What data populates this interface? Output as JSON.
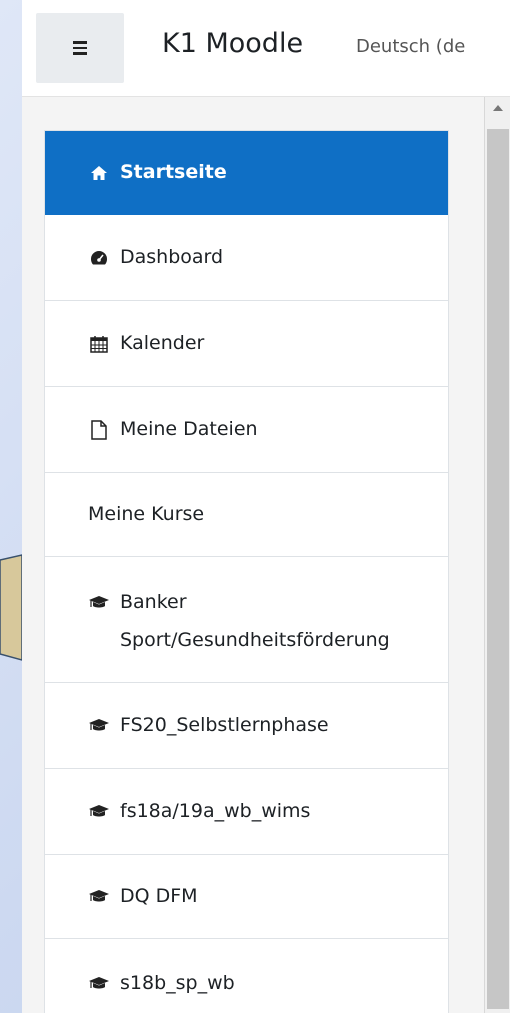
{
  "header": {
    "site_name": "K1 Moodle",
    "language": "Deutsch (de"
  },
  "nav": {
    "items": [
      {
        "label": "Startseite",
        "icon": "home-icon",
        "active": true
      },
      {
        "label": "Dashboard",
        "icon": "dashboard-icon"
      },
      {
        "label": "Kalender",
        "icon": "calendar-icon"
      },
      {
        "label": "Meine Dateien",
        "icon": "file-icon"
      },
      {
        "label": "Meine Kurse",
        "icon": ""
      },
      {
        "label": "Banker\nSport/Gesundheitsförderung",
        "icon": "graduation-cap-icon"
      },
      {
        "label": "FS20_Selbstlernphase",
        "icon": "graduation-cap-icon"
      },
      {
        "label": "fs18a/19a_wb_wims",
        "icon": "graduation-cap-icon"
      },
      {
        "label": "DQ DFM",
        "icon": "graduation-cap-icon"
      },
      {
        "label": "s18b_sp_wb",
        "icon": "graduation-cap-icon"
      }
    ]
  },
  "colors": {
    "accent": "#0f6fc5",
    "callout_fill": "#d7c89b"
  }
}
